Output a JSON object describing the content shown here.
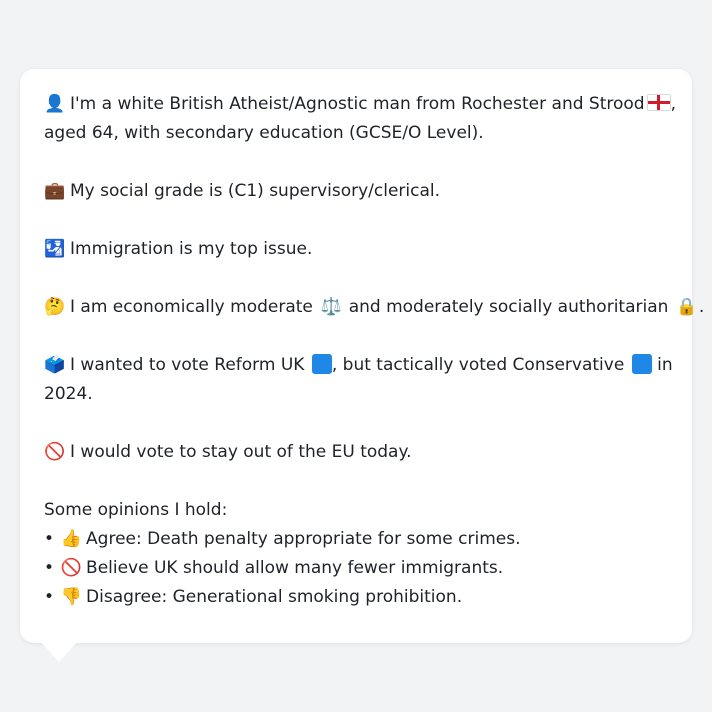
{
  "colors": {
    "background": "#f1f3f5",
    "card": "#ffffff",
    "text": "#1f2328",
    "reform_uk": "#12b6cf",
    "conservative": "#0087dc",
    "england_flag_red": "#cf1b2b"
  },
  "profile": {
    "identity": {
      "icon": "person-silhouette-icon",
      "icon_glyph": "👤",
      "line1": "I'm a white British Atheist/Agnostic man from Rochester and Strood",
      "flag_icon": "england-flag-icon",
      "line1_suffix": ",",
      "line2": "aged 64, with secondary education (GCSE/O Level)."
    },
    "social_grade": {
      "icon": "briefcase-icon",
      "icon_glyph": "💼",
      "text": "My social grade is (C1) supervisory/clerical."
    },
    "top_issue": {
      "icon": "passport-control-icon",
      "icon_glyph": "🛂",
      "text": "Immigration is my top issue."
    },
    "ideology": {
      "icon": "thinking-face-icon",
      "icon_glyph": "🤔",
      "text_part1": "I am economically moderate",
      "scales_icon": "balance-scale-icon",
      "scales_glyph": "⚖️",
      "text_part2": "and moderately socially authoritarian",
      "lock_icon": "lock-icon",
      "lock_glyph": "🔒",
      "text_part3": "."
    },
    "vote": {
      "icon": "ballot-box-icon",
      "icon_glyph": "🗳️",
      "text_part1": "I wanted to vote Reform UK",
      "text_part2": ", but tactically voted Conservative",
      "text_part3": "in",
      "line2": "2024."
    },
    "eu": {
      "icon": "prohibited-icon",
      "icon_glyph": "🚫",
      "text": "I would vote to stay out of the EU today."
    },
    "opinions": {
      "heading": "Some opinions I hold:",
      "bullet": "•",
      "items": [
        {
          "icon": "thumbs-up-icon",
          "glyph": "👍",
          "text": "Agree: Death penalty appropriate for some crimes."
        },
        {
          "icon": "prohibited-icon",
          "glyph": "🚫",
          "text": "Believe UK should allow many fewer immigrants."
        },
        {
          "icon": "thumbs-down-icon",
          "glyph": "👎",
          "text": "Disagree: Generational smoking prohibition."
        }
      ]
    }
  }
}
